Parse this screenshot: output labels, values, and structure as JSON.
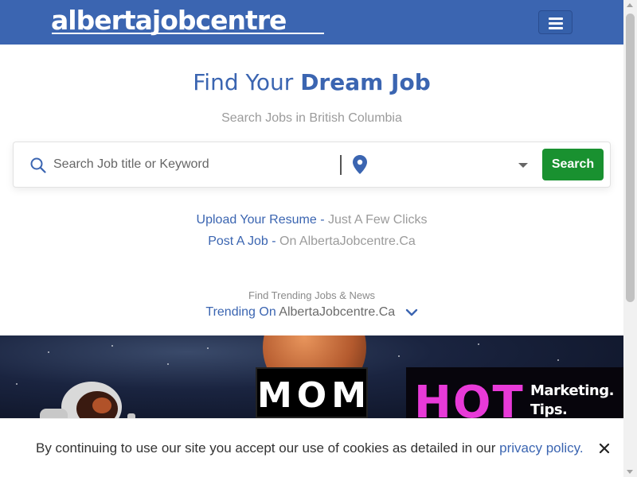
{
  "header": {
    "logo_text": "albertajobcentre",
    "menu_icon": "hamburger-icon"
  },
  "hero": {
    "title_plain": "Find Your ",
    "title_bold": "Dream Job",
    "subtitle": "Search Jobs in British Columbia",
    "search": {
      "placeholder": "Search Job title or Keyword",
      "location_value": "",
      "button_label": "Search"
    },
    "upload": {
      "link": "Upload Your Resume -",
      "note": " Just A Few Clicks"
    },
    "post": {
      "link": "Post A Job -",
      "note": " On AlbertaJobcentre.Ca"
    }
  },
  "trending": {
    "small": "Find Trending Jobs & News",
    "link": "Trending On",
    "site": " AlbertaJobcentre.Ca"
  },
  "banner": {
    "logo_text": "MOM",
    "hot_text": "HOT",
    "tagline": [
      "Marketing.",
      "Tips."
    ]
  },
  "cookie": {
    "text": "By continuing to use our site you accept our use of cookies as detailed in our ",
    "link": "privacy policy.",
    "close_icon": "close-icon"
  },
  "colors": {
    "brand_blue": "#3b65b1",
    "search_green": "#199130",
    "hot_pink": "#e83ad8"
  }
}
